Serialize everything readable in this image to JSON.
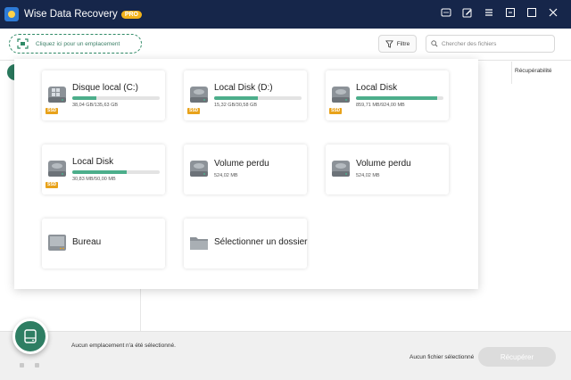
{
  "window": {
    "title": "Wise Data Recovery",
    "badge": "PRO"
  },
  "toolbar": {
    "location_label": "Cliquez ici pour un emplacement",
    "filter_label": "Filtre",
    "search_placeholder": "Chercher des fichiers"
  },
  "results": {
    "column_header": "Récupérabilité"
  },
  "locations": [
    {
      "name": "Disque local (C:)",
      "size": "38,04 GB/135,63 GB",
      "used_fraction": 0.28,
      "ssd": "SSD",
      "icon": "windows-drive-icon"
    },
    {
      "name": "Local Disk (D:)",
      "size": "15,32 GB/30,58 GB",
      "used_fraction": 0.5,
      "ssd": "SSD",
      "icon": "hard-drive-icon"
    },
    {
      "name": "Local Disk",
      "size": "859,71 MB/924,00 MB",
      "used_fraction": 0.93,
      "ssd": "SSD",
      "icon": "hard-drive-icon"
    },
    {
      "name": "Local Disk",
      "size": "30,83 MB/50,00 MB",
      "used_fraction": 0.62,
      "ssd": "SSD",
      "icon": "hard-drive-icon"
    },
    {
      "name": "Volume perdu",
      "size": "524,02 MB",
      "icon": "hard-drive-icon"
    },
    {
      "name": "Volume perdu",
      "size": "524,02 MB",
      "icon": "hard-drive-icon"
    },
    {
      "name": "Bureau",
      "icon": "desktop-icon"
    },
    {
      "name": "Sélectionner un dossier",
      "icon": "folder-icon"
    }
  ],
  "status": {
    "no_location": "Aucun emplacement n'a été sélectionné.",
    "no_file": "Aucun fichier sélectionné"
  },
  "recover_button": "Récupérer",
  "colors": {
    "titlebar": "#16264a",
    "accent": "#2e7e63",
    "usage_bar": "#4cae8b",
    "ssd_badge": "#e8a21a",
    "pro_badge": "#f2b21b"
  }
}
